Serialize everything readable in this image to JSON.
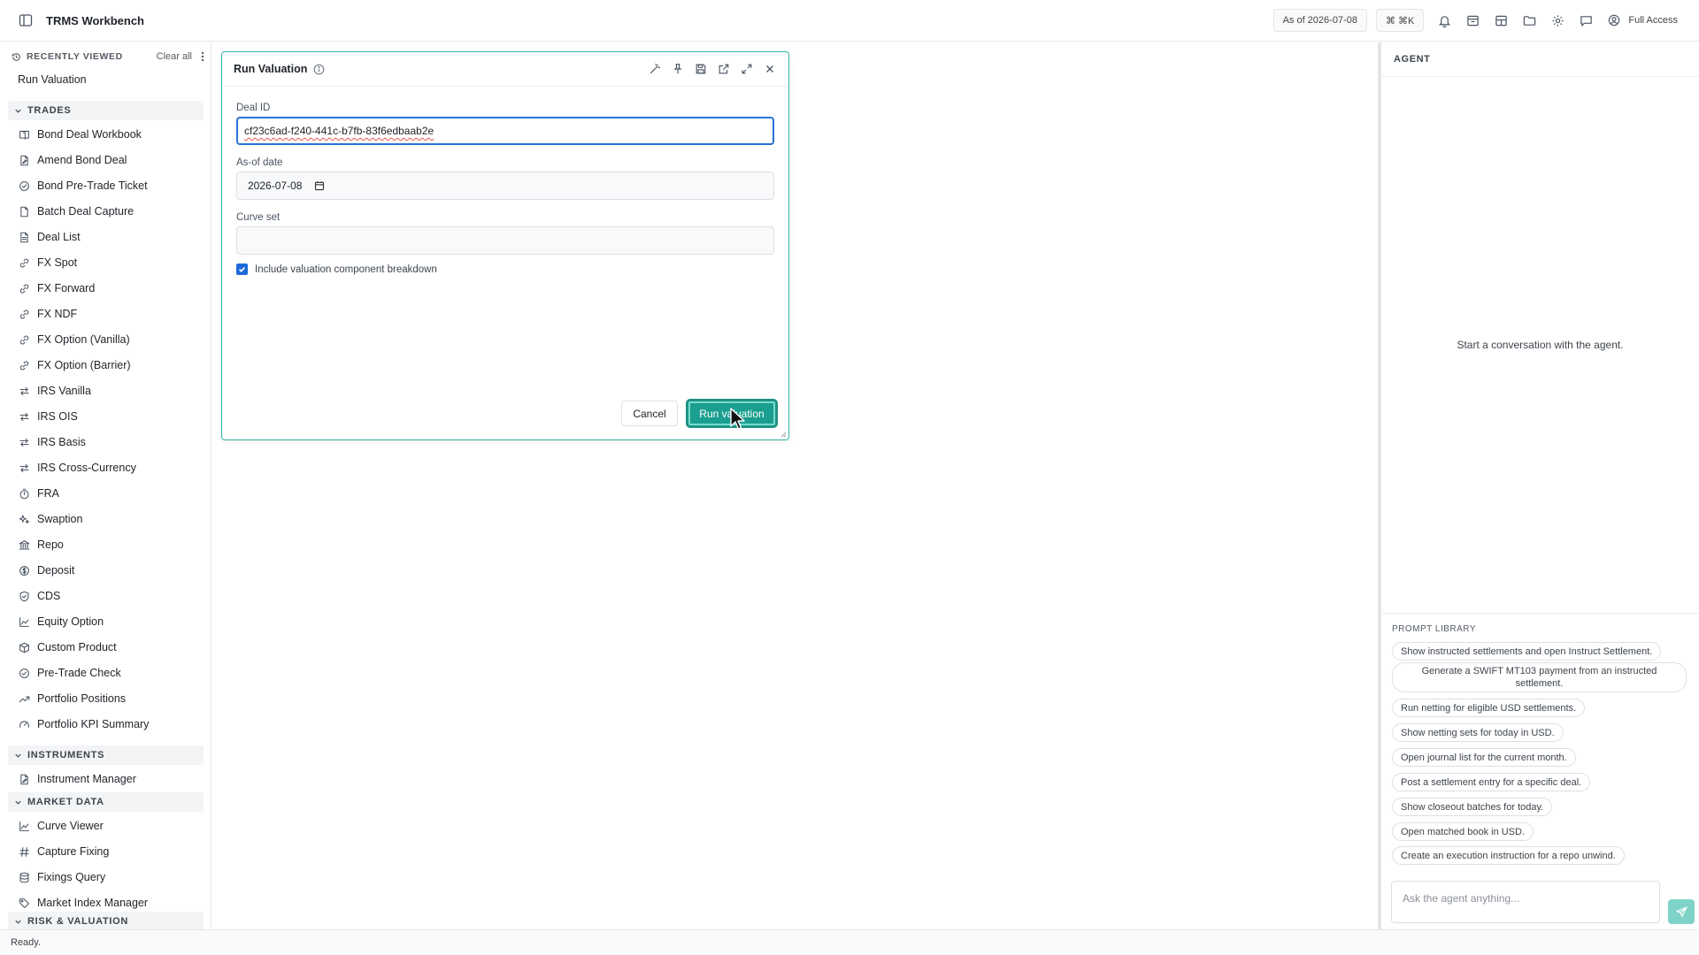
{
  "app": {
    "title": "TRMS Workbench"
  },
  "topbar": {
    "as_of": "As of 2026-07-08",
    "cmdk": "⌘ ⌘K",
    "access": "Full Access"
  },
  "sidebar": {
    "recently_viewed": "RECENTLY VIEWED",
    "clear_all": "Clear all",
    "recent_items": [
      "Run Valuation"
    ],
    "sections": {
      "trades": "TRADES",
      "instruments": "INSTRUMENTS",
      "market_data": "MARKET DATA",
      "risk": "RISK & VALUATION"
    },
    "trades": [
      {
        "label": "Bond Deal Workbook",
        "icon": "book-icon"
      },
      {
        "label": "Amend Bond Deal",
        "icon": "document-edit-icon"
      },
      {
        "label": "Bond Pre-Trade Ticket",
        "icon": "check-circle-icon"
      },
      {
        "label": "Batch Deal Capture",
        "icon": "document-icon"
      },
      {
        "label": "Deal List",
        "icon": "list-document-icon"
      },
      {
        "label": "FX Spot",
        "icon": "link-icon"
      },
      {
        "label": "FX Forward",
        "icon": "link-icon"
      },
      {
        "label": "FX NDF",
        "icon": "link-icon"
      },
      {
        "label": "FX Option (Vanilla)",
        "icon": "link-icon"
      },
      {
        "label": "FX Option (Barrier)",
        "icon": "link-icon"
      },
      {
        "label": "IRS Vanilla",
        "icon": "swap-icon"
      },
      {
        "label": "IRS OIS",
        "icon": "swap-icon"
      },
      {
        "label": "IRS Basis",
        "icon": "swap-icon"
      },
      {
        "label": "IRS Cross-Currency",
        "icon": "swap-icon"
      },
      {
        "label": "FRA",
        "icon": "timer-icon"
      },
      {
        "label": "Swaption",
        "icon": "sparkle-icon"
      },
      {
        "label": "Repo",
        "icon": "bank-icon"
      },
      {
        "label": "Deposit",
        "icon": "coin-icon"
      },
      {
        "label": "CDS",
        "icon": "shield-icon"
      },
      {
        "label": "Equity Option",
        "icon": "line-chart-icon"
      },
      {
        "label": "Custom Product",
        "icon": "box-icon"
      },
      {
        "label": "Pre-Trade Check",
        "icon": "check-circle-icon"
      },
      {
        "label": "Portfolio Positions",
        "icon": "trend-icon"
      },
      {
        "label": "Portfolio KPI Summary",
        "icon": "gauge-icon"
      }
    ],
    "instruments": [
      {
        "label": "Instrument Manager",
        "icon": "document-edit-icon"
      }
    ],
    "market_data": [
      {
        "label": "Curve Viewer",
        "icon": "line-chart-icon"
      },
      {
        "label": "Capture Fixing",
        "icon": "hash-icon"
      },
      {
        "label": "Fixings Query",
        "icon": "database-icon"
      },
      {
        "label": "Market Index Manager",
        "icon": "tag-icon"
      }
    ]
  },
  "dialog": {
    "title": "Run Valuation",
    "deal_id_label": "Deal ID",
    "deal_id_value": "cf23c6ad-f240-441c-b7fb-83f6edbaab2e",
    "as_of_label": "As-of date",
    "as_of_value": "2026-07-08",
    "curve_set_label": "Curve set",
    "curve_set_value": "",
    "checkbox_label": "Include valuation component breakdown",
    "checkbox_checked": true,
    "cancel": "Cancel",
    "run": "Run valuation"
  },
  "agent": {
    "title": "AGENT",
    "empty": "Start a conversation with the agent.",
    "prompt_library_title": "PROMPT LIBRARY",
    "prompts": [
      "Show instructed settlements and open Instruct Settlement.",
      "Generate a SWIFT MT103 payment from an instructed settlement.",
      "Run netting for eligible USD settlements.",
      "Show netting sets for today in USD.",
      "Open journal list for the current month.",
      "Post a settlement entry for a specific deal.",
      "Show closeout batches for today.",
      "Open matched book in USD.",
      "Create an execution instruction for a repo unwind."
    ],
    "input_placeholder": "Ask the agent anything..."
  },
  "status": {
    "text": "Ready."
  },
  "colors": {
    "accent": "#1a9e8f",
    "focus": "#2a72d8",
    "checkbox": "#1d6ad8"
  }
}
